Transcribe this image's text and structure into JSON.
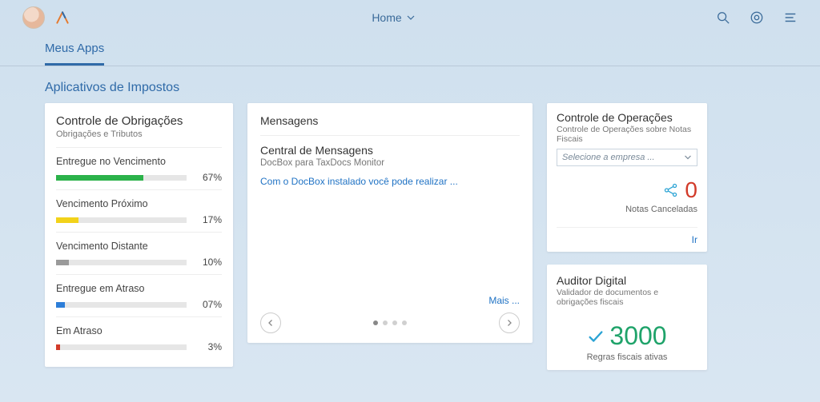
{
  "header": {
    "home_label": "Home"
  },
  "tabs": {
    "meus_apps": "Meus Apps"
  },
  "section": {
    "title": "Aplicativos de Impostos"
  },
  "obligations": {
    "title": "Controle de Obrigações",
    "subtitle": "Obrigações e Tributos",
    "items": [
      {
        "label": "Entregue no Vencimento",
        "pct": "67%",
        "width": 67,
        "color": "#2bb24a"
      },
      {
        "label": "Vencimento Próximo",
        "pct": "17%",
        "width": 17,
        "color": "#f2d21a"
      },
      {
        "label": "Vencimento Distante",
        "pct": "10%",
        "width": 10,
        "color": "#9a9a9a"
      },
      {
        "label": "Entregue em Atraso",
        "pct": "07%",
        "width": 7,
        "color": "#2d7ed8"
      },
      {
        "label": "Em Atraso",
        "pct": "3%",
        "width": 3,
        "color": "#d23b2a"
      }
    ]
  },
  "messages": {
    "title": "Mensagens",
    "item_title": "Central de Mensagens",
    "item_sub": "DocBox para TaxDocs Monitor",
    "item_link": "Com o DocBox instalado você pode realizar ...",
    "more": "Mais ..."
  },
  "operations": {
    "title": "Controle de Operações",
    "subtitle": "Controle de Operações sobre Notas Fiscais",
    "select_placeholder": "Selecione a empresa ...",
    "count": "0",
    "count_label": "Notas Canceladas",
    "go": "Ir"
  },
  "auditor": {
    "title": "Auditor Digital",
    "subtitle": "Validador de documentos e obrigações fiscais",
    "count": "3000",
    "count_label": "Regras fiscais ativas"
  }
}
